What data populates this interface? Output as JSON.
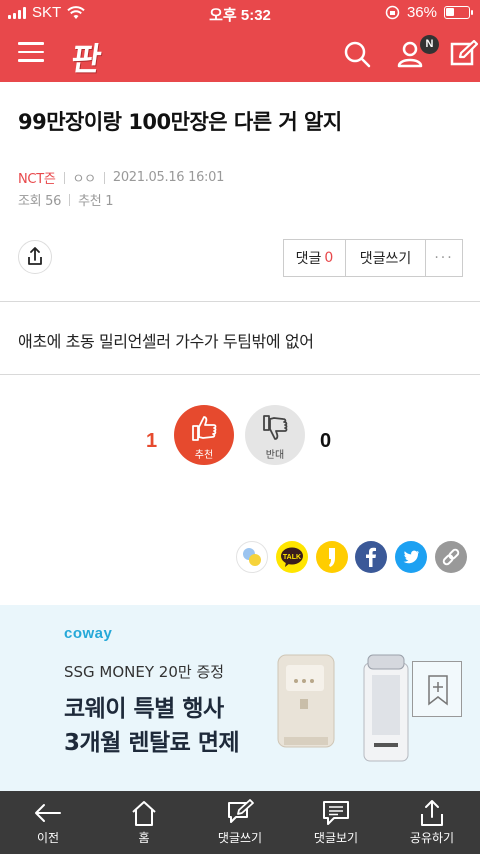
{
  "status_bar": {
    "carrier": "SKT",
    "time": "오후 5:32",
    "battery": "36%"
  },
  "header": {
    "logo": "판",
    "notification_badge": "N"
  },
  "post": {
    "title": "99만장이랑 100만장은 다른 거 알지",
    "author": "NCT즌",
    "author_id": "ㅇㅇ",
    "date": "2021.05.16 16:01",
    "views": "조회 56",
    "recommends": "추천 1",
    "body": "애초에 초동 밀리언셀러 가수가 두팀밖에 없어"
  },
  "actions": {
    "comment_label": "댓글",
    "comment_count": "0",
    "write_comment": "댓글쓰기",
    "more": "···"
  },
  "votes": {
    "up_count": "1",
    "up_label": "추천",
    "down_label": "반대",
    "down_count": "0"
  },
  "sns": [
    {
      "name": "band-icon",
      "color": "#ffffff"
    },
    {
      "name": "kakaotalk-icon",
      "color": "#ffe500",
      "label": "TALK"
    },
    {
      "name": "kakaostory-icon",
      "color": "#ffcd00"
    },
    {
      "name": "facebook-icon",
      "color": "#3b5998"
    },
    {
      "name": "twitter-icon",
      "color": "#1da1f2"
    },
    {
      "name": "link-icon",
      "color": "#999999"
    }
  ],
  "ad": {
    "brand": "coway",
    "subtitle": "SSG MONEY 20만 증정",
    "headline_1": "코웨이 특별 행사",
    "headline_2": "3개월 렌탈료 면제"
  },
  "bottom_nav": {
    "back": "이전",
    "home": "홈",
    "write_comment": "댓글쓰기",
    "view_comments": "댓글보기",
    "share": "공유하기"
  },
  "colors": {
    "brand": "#e8484b",
    "vote_up": "#e64a2e",
    "bottom_bar": "#3a3a3a"
  }
}
